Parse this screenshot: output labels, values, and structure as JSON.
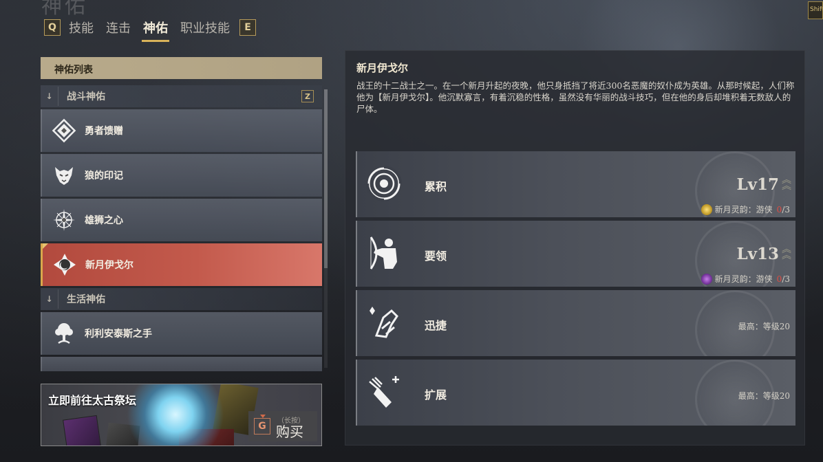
{
  "page_title_ghost": "神佑",
  "shift_key": "Shift",
  "tabs": {
    "prev_key": "Q",
    "next_key": "E",
    "items": [
      {
        "label": "技能",
        "active": false
      },
      {
        "label": "连击",
        "active": false
      },
      {
        "label": "神佑",
        "active": true
      },
      {
        "label": "职业技能",
        "active": false
      }
    ]
  },
  "list": {
    "header": "神佑列表",
    "categories": [
      {
        "label": "战斗神佑",
        "key": "Z"
      },
      {
        "label": "生活神佑"
      }
    ],
    "items": [
      {
        "label": "勇者馈赠",
        "icon": "diamond-emblem-icon"
      },
      {
        "label": "狼的印记",
        "icon": "wolf-head-icon"
      },
      {
        "label": "雄狮之心",
        "icon": "star-compass-icon"
      },
      {
        "label": "新月伊戈尔",
        "icon": "crescent-warrior-icon",
        "selected": true
      },
      {
        "label": "利利安泰斯之手",
        "icon": "tree-hand-icon"
      }
    ]
  },
  "banner": {
    "text": "立即前往太古祭坛",
    "key": "G",
    "hint": "（长按）",
    "buy_label": "购买"
  },
  "detail": {
    "title": "新月伊戈尔",
    "description": "战王的十二战士之一。在一个新月升起的夜晚，他只身抵挡了将近300名恶魔的奴仆成为英雄。从那时候起，人们称他为【新月伊戈尔】。他沉默寡言，有着沉稳的性格，虽然没有华丽的战斗技巧，但在他的身后却堆积着无数敌人的尸体。",
    "skills": [
      {
        "name": "累积",
        "icon": "spiral-target-icon",
        "level": "Lv17",
        "sub_label": "新月灵韵：游侠",
        "sub_count": "0",
        "sub_total": "/3",
        "sub_color": "#c9a52a"
      },
      {
        "name": "要领",
        "icon": "archer-icon",
        "level": "Lv13",
        "sub_label": "新月灵韵：游侠",
        "sub_count": "0",
        "sub_total": "/3",
        "sub_color": "#8a3fb0"
      },
      {
        "name": "迅捷",
        "icon": "swift-claw-icon",
        "max_label": "最高：等级20"
      },
      {
        "name": "扩展",
        "icon": "arrow-quiver-plus-icon",
        "max_label": "最高：等级20"
      }
    ]
  },
  "colors": {
    "accent_gold": "#d9b35a",
    "selected_red": "#c35a4c",
    "count_red": "#e24c42"
  }
}
